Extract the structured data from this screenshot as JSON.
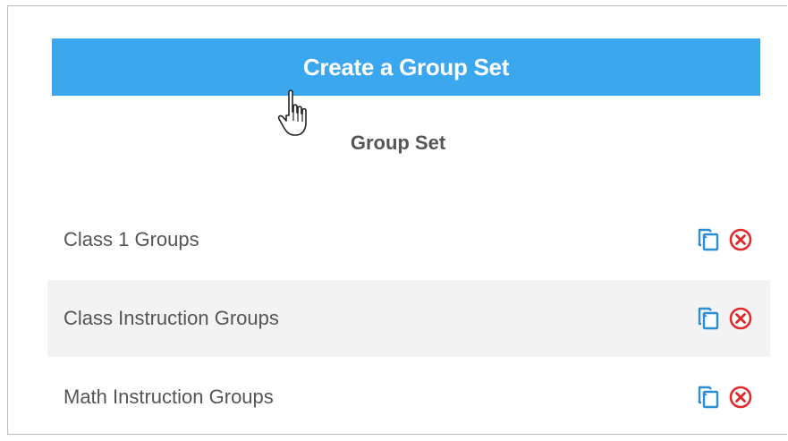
{
  "create_button": {
    "label": "Create a Group Set"
  },
  "section": {
    "title": "Group Set"
  },
  "group_sets": [
    {
      "name": "Class 1 Groups",
      "copy_icon": "copy-icon",
      "delete_icon": "delete-icon"
    },
    {
      "name": "Class Instruction Groups",
      "copy_icon": "copy-icon",
      "delete_icon": "delete-icon"
    },
    {
      "name": "Math Instruction Groups",
      "copy_icon": "copy-icon",
      "delete_icon": "delete-icon"
    }
  ],
  "colors": {
    "accent": "#3ba7ef",
    "copy_icon": "#2a8fd6",
    "delete_icon": "#e02a2a",
    "row_alt_bg": "#f3f3f3",
    "text": "#555555"
  },
  "cursor_icon": "hand-pointer-icon"
}
